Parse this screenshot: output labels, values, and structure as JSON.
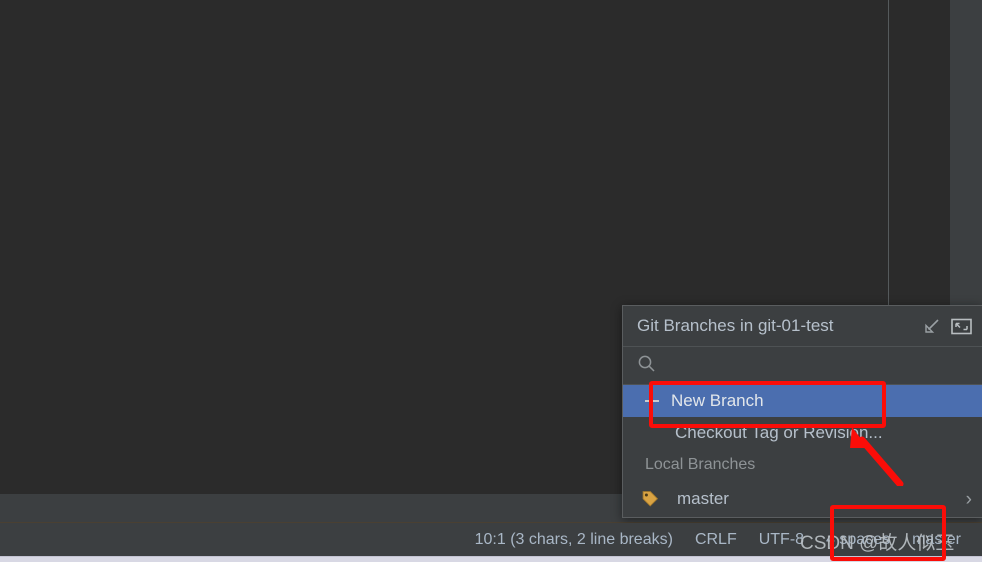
{
  "editor": {
    "background_color": "#2b2b2b",
    "guide_line_color": "#555a5c"
  },
  "popup": {
    "title": "Git Branches in git-01-test",
    "header_icons": [
      {
        "name": "settings-arrow-icon",
        "glyph": "arrow-down-left"
      },
      {
        "name": "restore-window-icon",
        "glyph": "restore-frame"
      }
    ],
    "search": {
      "placeholder": "",
      "value": "",
      "icon": "search-icon"
    },
    "items": [
      {
        "label": "New Branch",
        "icon": "new-branch-icon",
        "selected": true,
        "type": "action"
      },
      {
        "label": "Checkout Tag or Revision...",
        "icon": "",
        "selected": false,
        "type": "action"
      },
      {
        "label": "Local Branches",
        "icon": "",
        "selected": false,
        "type": "group"
      },
      {
        "label": "master",
        "icon": "branch-tag-icon",
        "selected": false,
        "type": "branch",
        "chevron": "›"
      }
    ],
    "selection_color": "#4b6eaf",
    "background_color": "#3c3f41"
  },
  "status_bar": {
    "caret_position": "10:1 (3 chars, 2 line breaks)",
    "line_separator": "CRLF",
    "encoding": "UTF-8",
    "indent": "4 spaces",
    "branch": "master",
    "text_color": "#a9b7c6"
  },
  "annotations": {
    "accent_color": "#fb0d08",
    "boxes": [
      {
        "name": "new-branch-highlight"
      },
      {
        "name": "branch-indicator-highlight"
      }
    ],
    "arrow": {
      "name": "pointer-arrow",
      "direction": "up-left"
    }
  },
  "watermark": {
    "text": "CSDN @故人似玉"
  }
}
